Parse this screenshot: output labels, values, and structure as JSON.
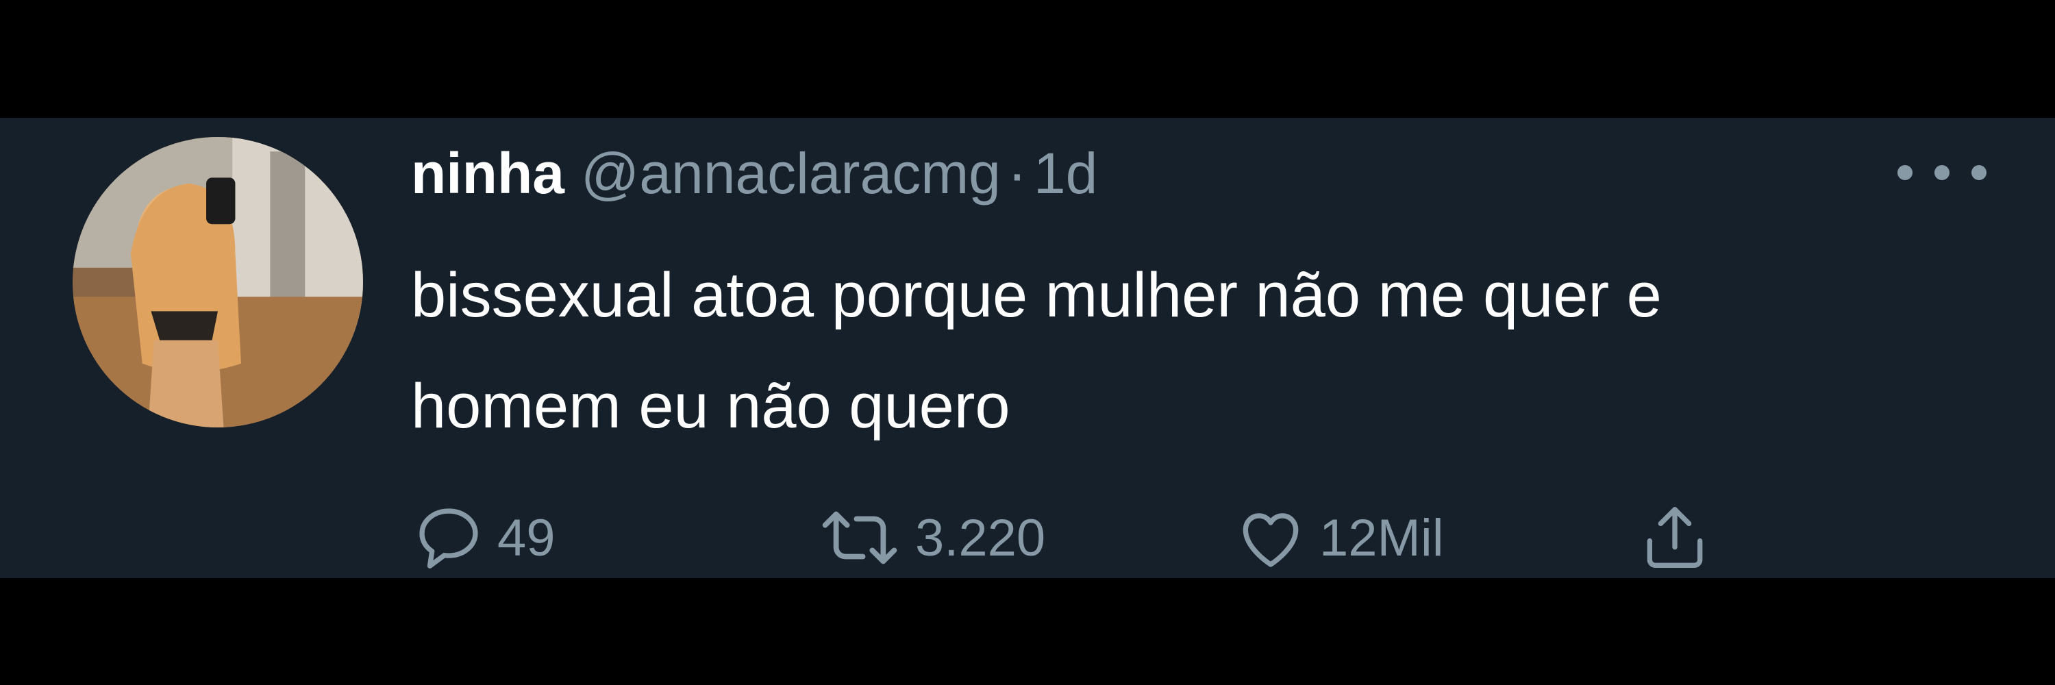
{
  "tweet": {
    "display_name": "ninha",
    "handle": "@annaclaracmg",
    "separator": "·",
    "time": "1d",
    "text": "bissexual atoa porque mulher não me quer e homem eu não quero",
    "avatar_icon": "profile-photo",
    "more_icon": "ellipsis-icon"
  },
  "actions": {
    "reply": {
      "icon": "reply-bubble-icon",
      "count": "49"
    },
    "retweet": {
      "icon": "retweet-arrows-icon",
      "count": "3.220"
    },
    "like": {
      "icon": "heart-icon",
      "count": "12Mil"
    },
    "share": {
      "icon": "share-upload-icon"
    }
  },
  "colors": {
    "background": "#000000",
    "card": "#16202b",
    "primary_text": "#ffffff",
    "secondary_text": "#8899a6"
  }
}
